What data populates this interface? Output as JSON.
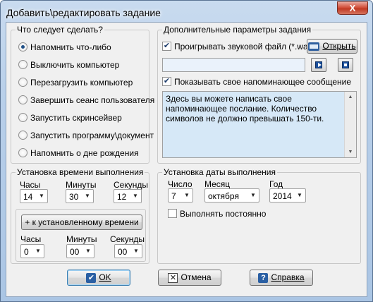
{
  "window": {
    "title": "Добавить\\редактировать задание",
    "close_glyph": "X"
  },
  "what_to_do": {
    "title": "Что следует сделать?",
    "options": [
      {
        "label": "Напомнить что-либо",
        "checked": true
      },
      {
        "label": "Выключить компьютер",
        "checked": false
      },
      {
        "label": "Перезагрузить компьютер",
        "checked": false
      },
      {
        "label": "Завершить сеанс пользователя",
        "checked": false
      },
      {
        "label": "Запустить скринсейвер",
        "checked": false
      },
      {
        "label": "Запустить программу\\документ",
        "checked": false
      },
      {
        "label": "Напомнить о дне рождения",
        "checked": false
      }
    ]
  },
  "extra": {
    "title": "Дополнительные параметры задания",
    "play_sound_label": "Проигрывать звуковой файл (*.wav)",
    "play_sound_checked": true,
    "open_button": "Открыть",
    "sound_path": "",
    "show_message_label": "Показывать свое напоминающее сообщение",
    "show_message_checked": true,
    "message_text": "Здесь вы можете написать свое напоминающее послание. Количество символов не должно превышать 150-ти."
  },
  "time": {
    "title": "Установка времени выполнения",
    "hours_label": "Часы",
    "minutes_label": "Минуты",
    "seconds_label": "Секунды",
    "hours": "14",
    "minutes": "30",
    "seconds": "12",
    "add_button": "+ к установленному времени",
    "add_hours": "0",
    "add_minutes": "00",
    "add_seconds": "00"
  },
  "date": {
    "title": "Установка даты выполнения",
    "day_label": "Число",
    "month_label": "Месяц",
    "year_label": "Год",
    "day": "7",
    "month": "октября",
    "year": "2014",
    "always_label": "Выполнять постоянно",
    "always_checked": false
  },
  "buttons": {
    "ok": "OK",
    "cancel": "Отмена",
    "help": "Справка"
  },
  "icons": {
    "close": "close-icon",
    "folder": "folder-open-icon",
    "play": "play-icon",
    "stop": "stop-icon",
    "ok": "checkmark-icon",
    "cancel": "cancel-x-icon",
    "help": "help-question-icon"
  },
  "colors": {
    "title_gradient_top": "#c9dbef",
    "close_red": "#c03a24",
    "client_bg": "#f0f0f0",
    "memo_bg": "#d6e8f7",
    "icon_blue": "#2a5fa3"
  }
}
